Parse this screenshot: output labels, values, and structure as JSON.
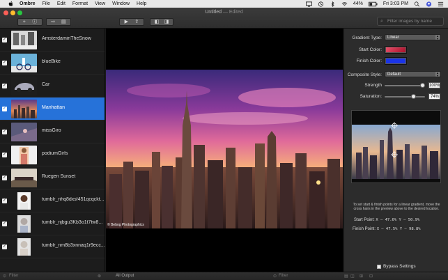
{
  "menubar": {
    "app_name": "Ombre",
    "items": [
      "File",
      "Edit",
      "Format",
      "View",
      "Window",
      "Help"
    ],
    "battery": "44%",
    "clock": "Fri 3:03 PM"
  },
  "window": {
    "title": "Untitled",
    "edited": "— Edited"
  },
  "toolbar": {
    "search_placeholder": "Filter images by name"
  },
  "images": [
    {
      "name": "AmsterdaminTheSnow",
      "checked": true,
      "selected": false
    },
    {
      "name": "blueBike",
      "checked": true,
      "selected": false
    },
    {
      "name": "Car",
      "checked": true,
      "selected": false
    },
    {
      "name": "Manhattan",
      "checked": true,
      "selected": true
    },
    {
      "name": "missGiro",
      "checked": true,
      "selected": false
    },
    {
      "name": "podiumGirls",
      "checked": true,
      "selected": false
    },
    {
      "name": "Ruegen Sunset",
      "checked": true,
      "selected": false
    },
    {
      "name": "tumblr_nhq8dxsf451qcqckt...",
      "checked": true,
      "selected": false
    },
    {
      "name": "tumblr_njbgu3Kb3o1t7tw8...",
      "checked": true,
      "selected": false
    },
    {
      "name": "tumblr_nm8b3xnnaq1r9ecc...",
      "checked": true,
      "selected": false
    }
  ],
  "photo": {
    "credit": "© Bebog Photographics"
  },
  "inspector": {
    "gradient_type_label": "Gradient Type:",
    "gradient_type_value": "Linear",
    "start_color_label": "Start Color:",
    "finish_color_label": "Finish Color:",
    "composite_style_label": "Composite Style:",
    "composite_style_value": "Default",
    "strength_label": "Strength",
    "strength_value": "100%",
    "strength_fraction": 1.0,
    "saturation_label": "Saturation:",
    "saturation_value": "74%",
    "saturation_fraction": 0.74,
    "help_text": "To set start & finish points for a linear gradient, move the cross hairs in the preview above to the desired location.",
    "start_point_label": "Start Point:",
    "start_point_value": "X – 47.6%  Y – 50.9%",
    "finish_point_label": "Finish Point:",
    "finish_point_value": "X – 47.5%  Y – 98.8%",
    "bypass_label": "Bypass Settings"
  },
  "colors": {
    "start": "#cc2244",
    "finish": "#1133dd",
    "selection": "#2672d9"
  },
  "bottombar": {
    "filter_left": "Filter",
    "output_popup": "All Output",
    "filter_right": "Filter"
  }
}
